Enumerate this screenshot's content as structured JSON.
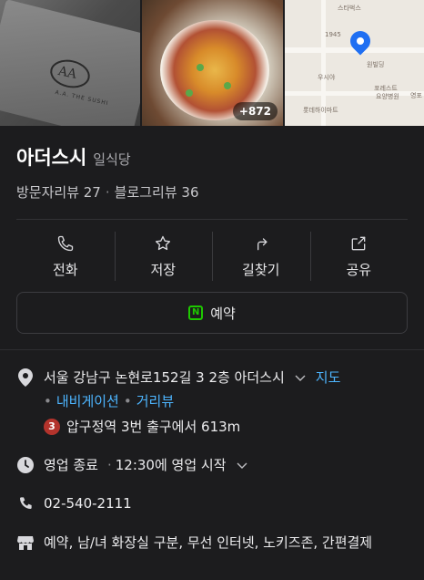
{
  "photos": {
    "more_count": "+872",
    "logo_text": "AA",
    "logo_sub": "A.A. THE SUSHI",
    "map_labels": [
      "스타벅스",
      "1945",
      "원빌딩",
      "우시야",
      "포레스트",
      "요양병원",
      "영포",
      "롯데하이마트"
    ]
  },
  "place": {
    "name": "아더스시",
    "category": "일식당",
    "visitor_reviews": "방문자리뷰 27",
    "blog_reviews": "블로그리뷰 36"
  },
  "actions": [
    {
      "label": "전화",
      "icon": "phone-icon"
    },
    {
      "label": "저장",
      "icon": "star-icon"
    },
    {
      "label": "길찾기",
      "icon": "directions-icon"
    },
    {
      "label": "공유",
      "icon": "share-icon"
    }
  ],
  "reserve": {
    "label": "예약",
    "icon_letter": "N"
  },
  "info": {
    "address": "서울 강남구 논현로152길 3 2층 아더스시",
    "map_link": "지도",
    "navigation_link": "내비게이션",
    "distance_link": "거리뷰",
    "subway_line": "3",
    "subway_text": "압구정역 3번 출구에서 613m",
    "hours_status": "영업 종료",
    "hours_next": "12:30에 영업 시작",
    "phone": "02-540-2111",
    "amenities": "예약, 남/녀 화장실 구분, 무선 인터넷, 노키즈존, 간편결제"
  },
  "colors": {
    "background": "#1c1c1e",
    "link": "#4db5ff",
    "naver_green": "#1ec800",
    "subway_line3": "#b3332c"
  }
}
